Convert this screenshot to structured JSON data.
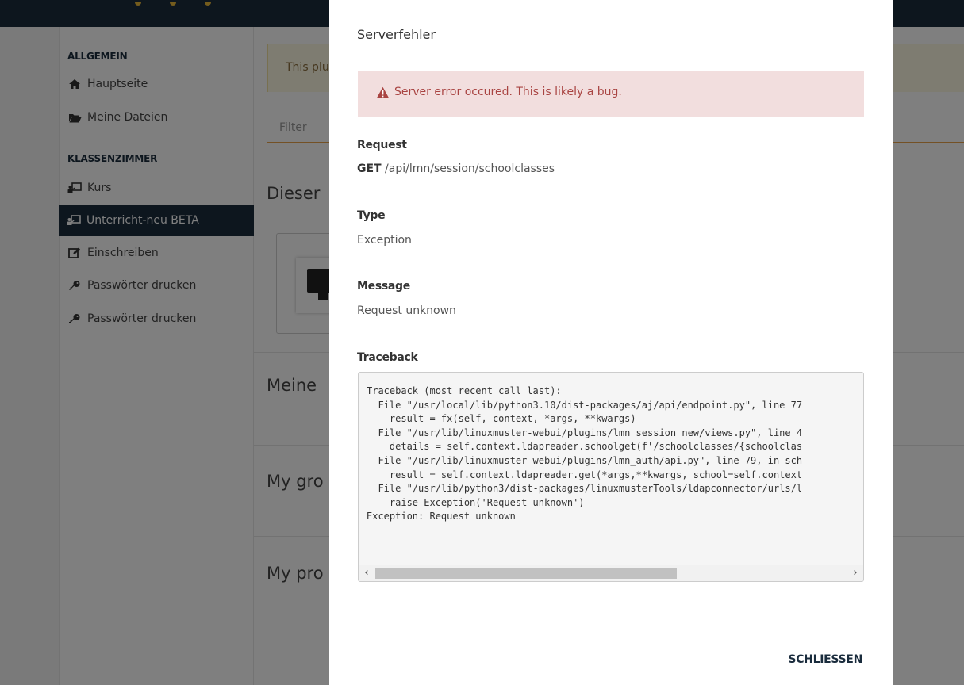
{
  "sidebar": {
    "sections": [
      {
        "title": "ALLGEMEIN",
        "items": [
          {
            "label": "Hauptseite",
            "icon": "home-icon"
          },
          {
            "label": "Meine Dateien",
            "icon": "folder-icon"
          }
        ]
      },
      {
        "title": "KLASSENZIMMER",
        "items": [
          {
            "label": "Kurs",
            "icon": "classroom-icon"
          },
          {
            "label": "Unterricht-neu BETA",
            "icon": "classroom-icon",
            "active": true
          },
          {
            "label": "Einschreiben",
            "icon": "edit-icon"
          },
          {
            "label": "Passwörter drucken",
            "icon": "key-icon"
          },
          {
            "label": "Passwörter drucken",
            "icon": "key-icon"
          }
        ]
      }
    ]
  },
  "main": {
    "notice": "This plu",
    "filter_placeholder": "Filter",
    "headings": [
      "Dieser",
      "Meine",
      "My gro",
      "My pro"
    ]
  },
  "modal": {
    "title": "Serverfehler",
    "alert": "Server error occured. This is likely a bug.",
    "request_label": "Request",
    "request_method": "GET",
    "request_path": " /api/lmn/session/schoolclasses",
    "type_label": "Type",
    "type_value": "Exception",
    "message_label": "Message",
    "message_value": "Request unknown",
    "traceback_label": "Traceback",
    "traceback": "Traceback (most recent call last):\n  File \"/usr/local/lib/python3.10/dist-packages/aj/api/endpoint.py\", line 77\n    result = fx(self, context, *args, **kwargs)\n  File \"/usr/lib/linuxmuster-webui/plugins/lmn_session_new/views.py\", line 4\n    details = self.context.ldapreader.schoolget(f'/schoolclasses/{schoolclas\n  File \"/usr/lib/linuxmuster-webui/plugins/lmn_auth/api.py\", line 79, in sch\n    result = self.context.ldapreader.get(*args,**kwargs, school=self.context\n  File \"/usr/lib/python3/dist-packages/linuxmusterTools/ldapconnector/urls/l\n    raise Exception('Request unknown')\nException: Request unknown",
    "close_label": "SCHLIESSEN"
  },
  "colors": {
    "navy": "#1a2c3d",
    "alert_bg": "#f2dede",
    "alert_text": "#a94442",
    "accent": "#e8a34b"
  }
}
